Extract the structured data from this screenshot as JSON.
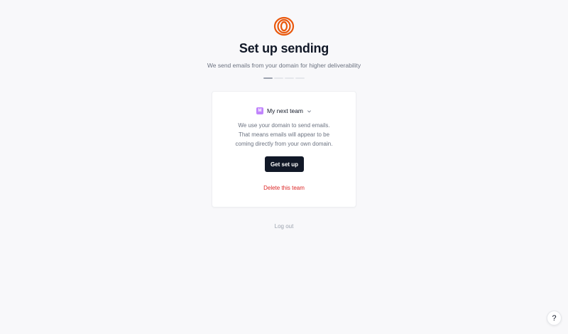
{
  "header": {
    "logo_icon": "brand-rings-icon",
    "title": "Set up sending",
    "subtitle": "We send emails from your domain for higher deliverability"
  },
  "progress": {
    "total_steps": 4,
    "current_step": 1
  },
  "card": {
    "team": {
      "badge": "M",
      "name": "My next team",
      "badge_color": "#c084fc"
    },
    "description_lines": [
      "We use your domain to send emails.",
      "That means emails will appear to be",
      "coming directly from your own domain."
    ],
    "primary_button": "Get set up",
    "delete_link": "Delete this team"
  },
  "footer": {
    "logout": "Log out"
  },
  "help_button": {
    "icon": "question-icon",
    "label": "?"
  },
  "colors": {
    "brand": "#ea580c",
    "primary_button": "#111827",
    "danger": "#dc2626"
  }
}
